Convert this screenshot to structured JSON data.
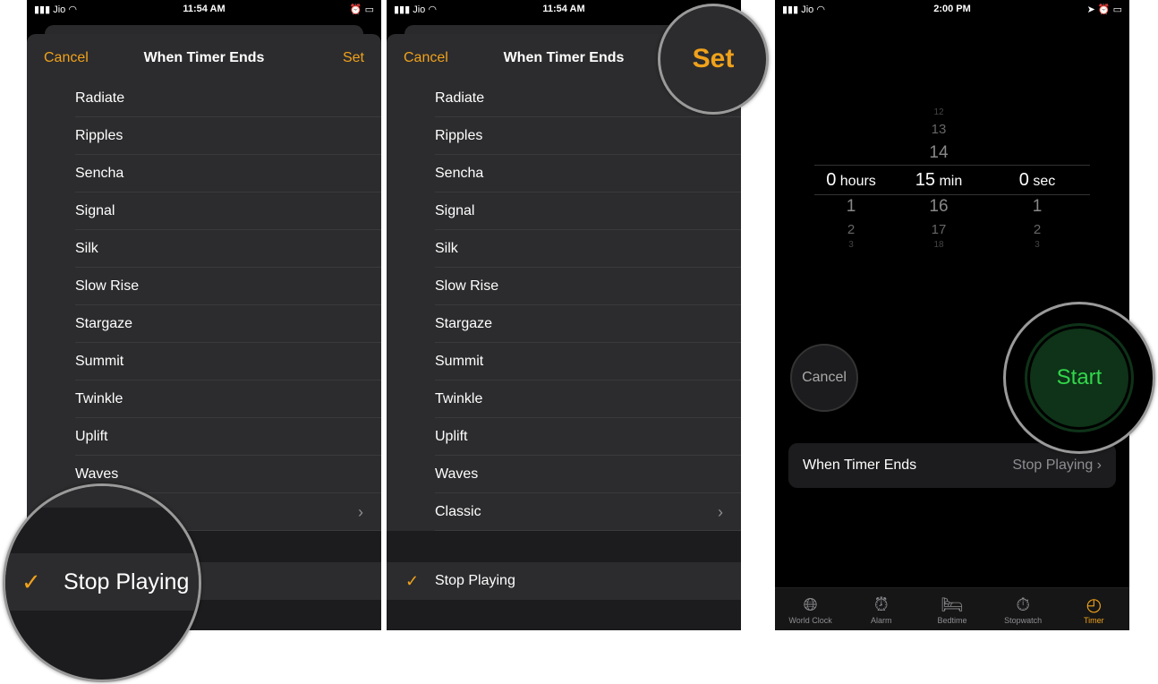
{
  "status_bar_1": {
    "carrier": "Jio",
    "time": "11:54 AM"
  },
  "status_bar_2": {
    "carrier": "Jio",
    "time": "11:54 AM"
  },
  "status_bar_3": {
    "carrier": "Jio",
    "time": "2:00 PM"
  },
  "sheet": {
    "cancel": "Cancel",
    "title": "When Timer Ends",
    "set": "Set"
  },
  "sounds": [
    "Radiate",
    "Ripples",
    "Sencha",
    "Signal",
    "Silk",
    "Slow Rise",
    "Stargaze",
    "Summit",
    "Twinkle",
    "Uplift",
    "Waves",
    "Classic"
  ],
  "stop_playing": "Stop Playing",
  "accent": "#f0a21b",
  "picker": {
    "hours": {
      "above": [],
      "selected": "0",
      "unit": "hours",
      "below": [
        "1",
        "2",
        "3"
      ]
    },
    "minutes": {
      "above": [
        "12",
        "13",
        "14"
      ],
      "selected": "15",
      "unit": "min",
      "below": [
        "16",
        "17",
        "18"
      ]
    },
    "seconds": {
      "above": [],
      "selected": "0",
      "unit": "sec",
      "below": [
        "1",
        "2",
        "3"
      ]
    }
  },
  "timer": {
    "cancel": "Cancel",
    "start": "Start",
    "when_label": "When Timer Ends",
    "when_value": "Stop Playing",
    "start_color": "#32d74b"
  },
  "tabs": [
    {
      "label": "World Clock",
      "icon": "globe-icon"
    },
    {
      "label": "Alarm",
      "icon": "alarm-clock-icon"
    },
    {
      "label": "Bedtime",
      "icon": "bed-icon"
    },
    {
      "label": "Stopwatch",
      "icon": "stopwatch-icon"
    },
    {
      "label": "Timer",
      "icon": "timer-icon",
      "active": true
    }
  ]
}
